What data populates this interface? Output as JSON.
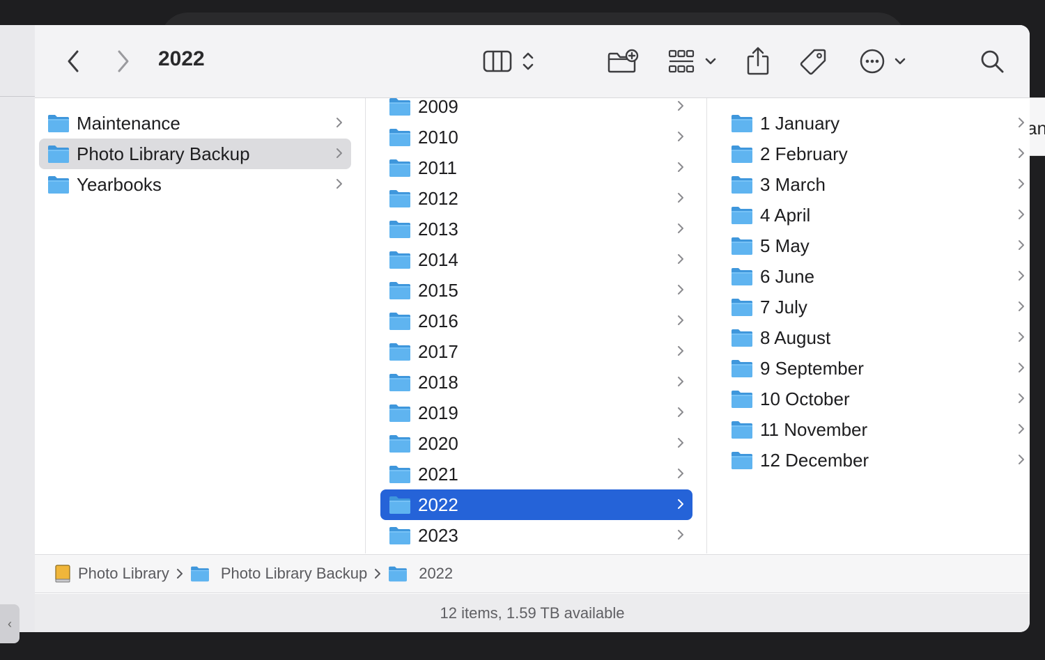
{
  "toolbar": {
    "title": "2022",
    "icons": [
      "back-icon",
      "forward-icon",
      "column-view-icon",
      "view-switch-chevrons-icon",
      "new-folder-icon",
      "group-icon",
      "chevron-down-icon",
      "share-icon",
      "tag-icon",
      "more-icon",
      "search-icon"
    ]
  },
  "columns": {
    "col1": [
      {
        "label": "Maintenance",
        "selected": false
      },
      {
        "label": "Photo Library Backup",
        "selected": true
      },
      {
        "label": "Yearbooks",
        "selected": false
      }
    ],
    "col2": [
      {
        "label": "2009"
      },
      {
        "label": "2010"
      },
      {
        "label": "2011"
      },
      {
        "label": "2012"
      },
      {
        "label": "2013"
      },
      {
        "label": "2014"
      },
      {
        "label": "2015"
      },
      {
        "label": "2016"
      },
      {
        "label": "2017"
      },
      {
        "label": "2018"
      },
      {
        "label": "2019"
      },
      {
        "label": "2020"
      },
      {
        "label": "2021"
      },
      {
        "label": "2022",
        "selected": true
      },
      {
        "label": "2023"
      }
    ],
    "col3": [
      {
        "label": "1 January"
      },
      {
        "label": "2 February"
      },
      {
        "label": "3 March"
      },
      {
        "label": "4 April"
      },
      {
        "label": "5 May"
      },
      {
        "label": "6 June"
      },
      {
        "label": "7 July"
      },
      {
        "label": "8 August"
      },
      {
        "label": "9 September"
      },
      {
        "label": "10 October"
      },
      {
        "label": "11 November"
      },
      {
        "label": "12 December"
      }
    ]
  },
  "pathbar": {
    "crumbs": [
      {
        "label": "Photo Library",
        "icon": "drive-icon"
      },
      {
        "label": "Photo Library Backup",
        "icon": "folder-icon"
      },
      {
        "label": "2022",
        "icon": "folder-icon"
      }
    ]
  },
  "status": {
    "text": "12 items, 1.59 TB available"
  },
  "colors": {
    "folder": "#5fb4f0",
    "folder_tab": "#3f97dc",
    "selected_blue": "#2563d8",
    "selected_gray": "#dcdcdf"
  }
}
